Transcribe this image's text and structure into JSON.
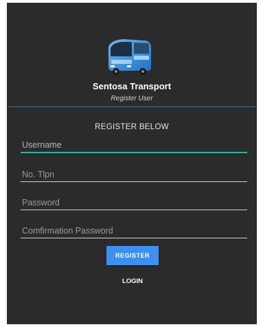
{
  "app": {
    "name": "Sentosa Transport",
    "subtitle": "Register User",
    "logo_icon": "bus-icon"
  },
  "form": {
    "heading": "REGISTER BELOW",
    "fields": [
      {
        "placeholder": "Username",
        "value": "",
        "focused": true
      },
      {
        "placeholder": "No. Tlpn",
        "value": "",
        "focused": false
      },
      {
        "placeholder": "Password",
        "value": "",
        "focused": false
      },
      {
        "placeholder": "Comfirmation Password",
        "value": "",
        "focused": false
      }
    ],
    "register_label": "REGISTER",
    "login_label": "LOGIN"
  },
  "colors": {
    "background": "#2b2b2b",
    "accent": "#3d8ff0",
    "focus_underline": "#2fb4a4",
    "divider": "#4a6fa8"
  }
}
